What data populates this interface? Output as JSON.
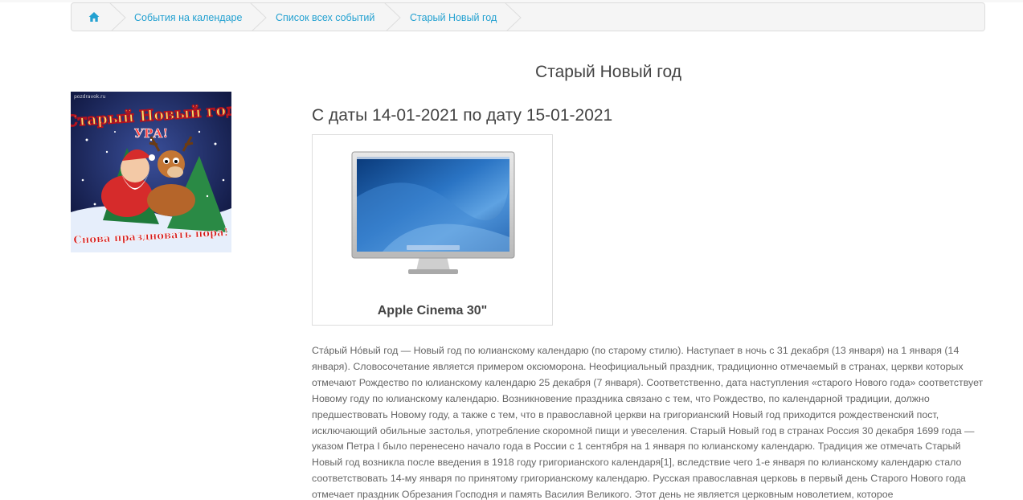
{
  "breadcrumb": {
    "items": [
      {
        "label": "События на календаре"
      },
      {
        "label": "Список всех событий"
      },
      {
        "label": "Старый Новый год"
      }
    ]
  },
  "event": {
    "title": "Старый Новый год",
    "date_range": "С даты 14-01-2021 по дату 15-01-2021",
    "image_caption": "Старый Новый год УРА! Снова праздновать пора!",
    "image_site": "pozdravok.ru"
  },
  "product": {
    "name": "Apple Cinema 30\""
  },
  "description": "Ста́рый Но́вый год — Новый год по юлианскому календарю (по старому стилю). Наступает в ночь с 31 декабря (13 января) на 1 января (14 января). Словосочетание является примером оксюморона. Неофициальный праздник, традиционно отмечаемый в странах, церкви которых отмечают Рождество по юлианскому календарю 25 декабря (7 января). Соответственно, дата наступления «старого Нового года» соответствует Новому году по юлианскому календарю. Возникновение праздника связано с тем, что Рождество, по календарной традиции, должно предшествовать Новому году, а также с тем, что в православной церкви на григорианский Новый год приходится рождественский пост, исключающий обильные застолья, употребление скоромной пищи и увеселения. Старый Новый год в странах Россия 30 декабря 1699 года — указом Петра I было перенесено начало года в России с 1 сентября на 1 января по юлианскому календарю. Традиция же отмечать Старый Новый год возникла после введения в 1918 году григорианского календаря[1], вследствие чего 1-е января по юлианскому календарю стало соответствовать 14-му января по принятому григорианскому календарю. Русская православная церковь в первый день Старого Нового года отмечает праздник Обрезания Господня и память Василия Великого. Этот день не является церковным новолетием, которое",
  "colors": {
    "link": "#23a1d1",
    "heading": "#444444",
    "text": "#666666",
    "breadcrumb_bg": "#f5f5f5"
  },
  "icons": {
    "home": "home-icon",
    "separator": "breadcrumb-chevron"
  }
}
